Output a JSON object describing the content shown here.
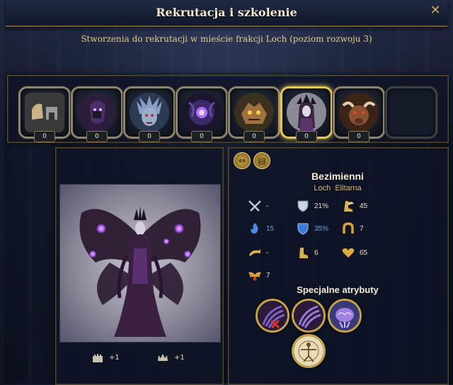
{
  "window": {
    "title": "Rekrutacja i szkolenie",
    "close_icon": "close-icon",
    "subtitle": "Stworzenia do rekrutacji w mieście frakcji Loch (poziom rozwoju 3)"
  },
  "creatures": [
    {
      "name": "caravan-slot",
      "count": "0",
      "icon": "caravan-icon",
      "selected": false
    },
    {
      "name": "assassin-slot",
      "count": "0",
      "icon": "assassin-portrait",
      "selected": false
    },
    {
      "name": "blood-maiden-slot",
      "count": "0",
      "icon": "fury-portrait",
      "selected": false
    },
    {
      "name": "minotaur-slot",
      "count": "0",
      "icon": "seer-portrait",
      "selected": false
    },
    {
      "name": "dragon-slot",
      "count": "0",
      "icon": "lizard-portrait",
      "selected": false
    },
    {
      "name": "faceless-slot",
      "count": "0",
      "icon": "faceless-portrait",
      "selected": true
    },
    {
      "name": "dragon-black-slot",
      "count": "0",
      "icon": "minotaur-portrait",
      "selected": false
    },
    {
      "name": "empty-slot",
      "count": "",
      "icon": "",
      "selected": false
    }
  ],
  "unit": {
    "name": "Bezimienni",
    "faction": "Loch",
    "tier": "Elitarna",
    "bonuses": [
      {
        "icon": "castle-icon",
        "value": "+1"
      },
      {
        "icon": "crown-icon",
        "value": "+1"
      }
    ],
    "stats": {
      "attack": {
        "icon": "crossed-swords-icon",
        "value": "-"
      },
      "defense": {
        "icon": "shield-icon",
        "value": "21%"
      },
      "initiative": {
        "icon": "winged-boot-icon",
        "value": "45"
      },
      "magic_attack": {
        "icon": "blue-flame-icon",
        "value": "15"
      },
      "magic_defense": {
        "icon": "blue-shield-icon",
        "value": "35%"
      },
      "luck": {
        "icon": "horseshoe-icon",
        "value": "7"
      },
      "ranged": {
        "icon": "horn-icon",
        "value": "-"
      },
      "speed": {
        "icon": "boot-icon",
        "value": "6"
      },
      "health": {
        "icon": "heart-icon",
        "value": "65"
      },
      "morale": {
        "icon": "wings-icon",
        "value": "7"
      }
    },
    "specials_title": "Specjalne atrybuty",
    "abilities": [
      {
        "name": "ability-no-retaliation",
        "icon": "claw-crossed-icon"
      },
      {
        "name": "ability-shadow-claws",
        "icon": "claw-icon"
      },
      {
        "name": "ability-mind-reading",
        "icon": "brain-icon"
      },
      {
        "name": "ability-living",
        "icon": "vitruvian-icon"
      }
    ]
  },
  "colors": {
    "accent_gold": "#c4a24c",
    "selected_border": "#e6c65a",
    "blue_value": "#6fa0e8"
  }
}
